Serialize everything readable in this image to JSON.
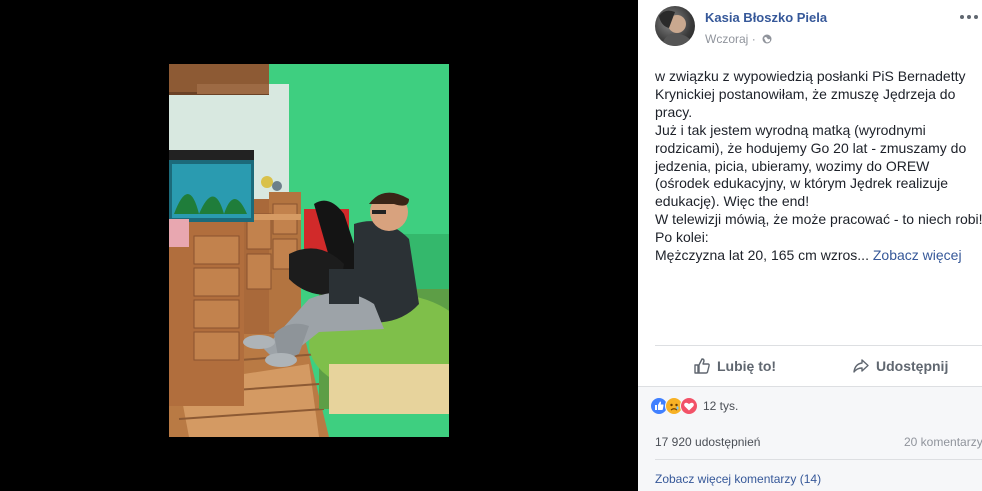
{
  "post": {
    "author": "Kasia Błoszko Piela",
    "time": "Wczoraj",
    "separator": "·",
    "privacy_icon": "globe-icon",
    "text_lines": [
      "w związku z wypowiedzią posłanki PiS Bernadetty",
      "Krynickiej postanowiłam, że zmuszę Jędrzeja do",
      "pracy.",
      "Już i tak jestem wyrodną matką (wyrodnymi",
      "rodzicami), że hodujemy Go 20 lat - zmuszamy do",
      "jedzenia, picia, ubieramy, wozimy do OREW",
      "(ośrodek edukacyjny, w którym Jędrek realizuje",
      "edukację). Więc the end!",
      "W telewizji mówią, że może pracować - to niech robi!",
      "Po kolei:"
    ],
    "truncated_line": "Mężczyzna lat 20, 165 cm wzros...",
    "see_more": "Zobacz więcej"
  },
  "actions": {
    "like": "Lubię to!",
    "share": "Udostępnij"
  },
  "stats": {
    "reaction_icons": [
      "like-icon",
      "sad-icon",
      "love-icon"
    ],
    "reactions": "12 tys.",
    "shares": "17 920 udostępnień",
    "comments": "20 komentarzy",
    "see_more_comments": "Zobacz więcej komentarzy (14)"
  },
  "colors": {
    "link": "#365899",
    "text": "#1d2129",
    "muted": "#90949c",
    "like": "#4080ff",
    "sad": "#f7b125",
    "love": "#f25268"
  }
}
